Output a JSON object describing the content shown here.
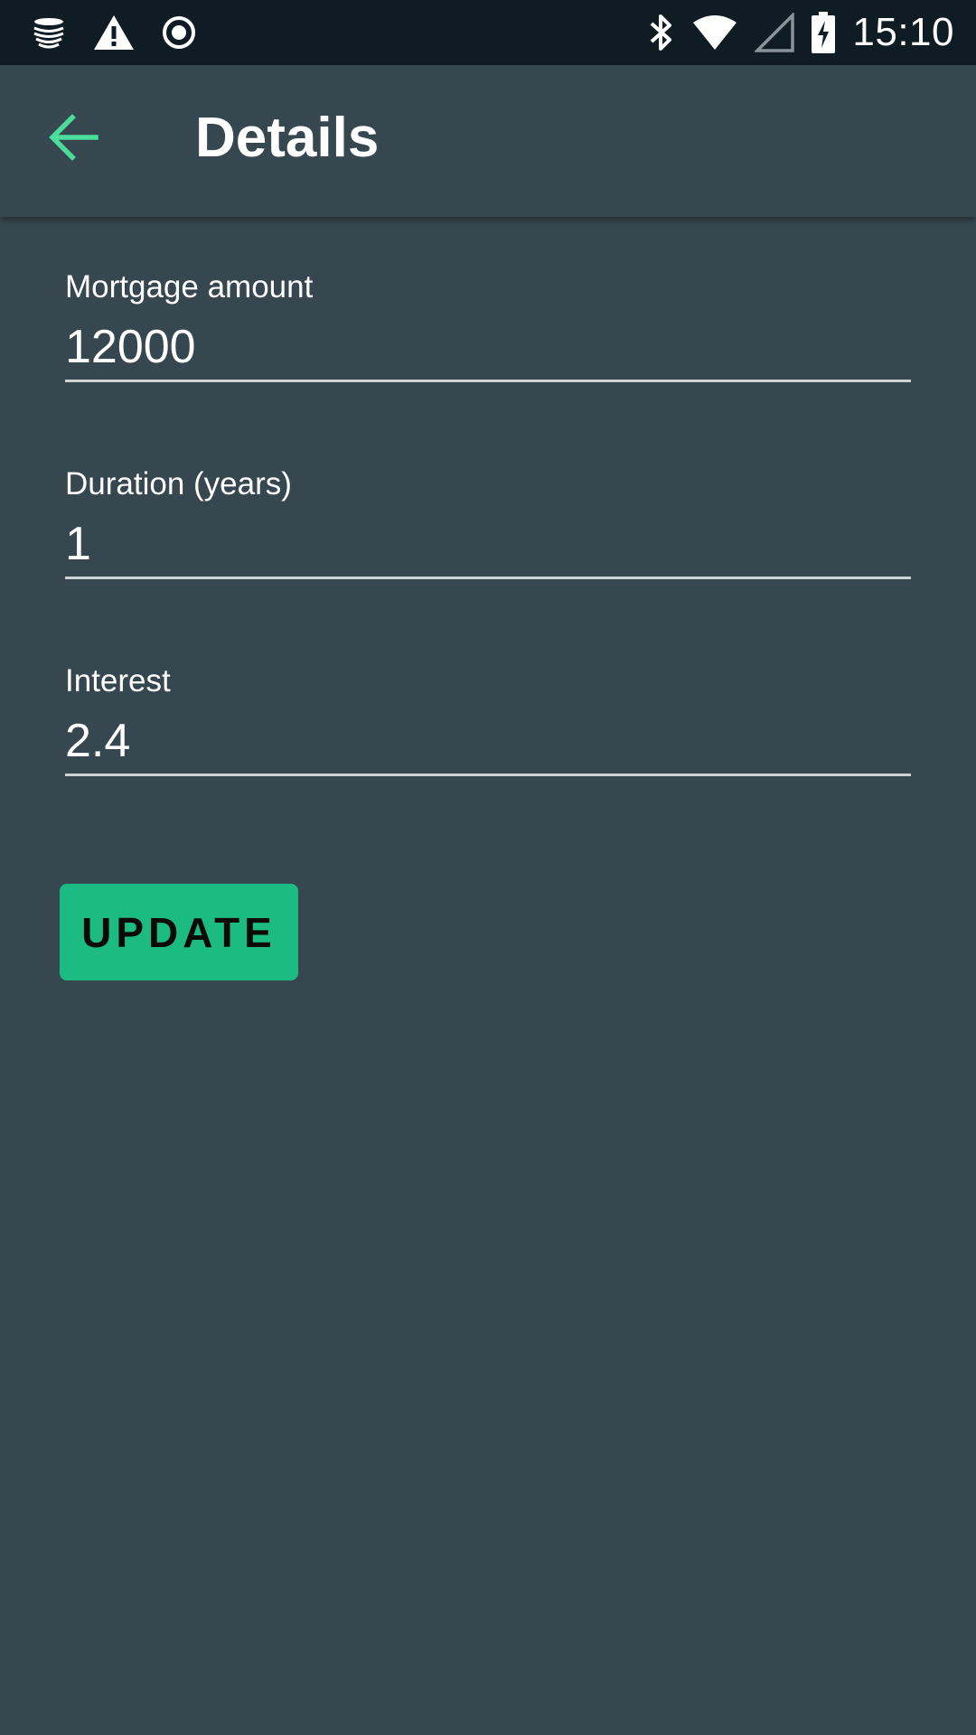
{
  "status_bar": {
    "time": "15:10",
    "icons_left": [
      "stacked-layers-icon",
      "warning-icon",
      "record-icon"
    ],
    "icons_right": [
      "bluetooth-icon",
      "wifi-icon",
      "cell-signal-icon",
      "battery-charging-icon"
    ]
  },
  "app_bar": {
    "title": "Details",
    "back_icon": "arrow-back-icon",
    "accent_color": "#4ade9a"
  },
  "form": {
    "fields": [
      {
        "label": "Mortgage amount",
        "value": "12000"
      },
      {
        "label": "Duration (years)",
        "value": "1"
      },
      {
        "label": "Interest",
        "value": "2.4"
      }
    ],
    "update_label": "UPDATE"
  },
  "colors": {
    "background": "#37474f",
    "status_bar": "#0f1c24",
    "button": "#1dbb84"
  }
}
